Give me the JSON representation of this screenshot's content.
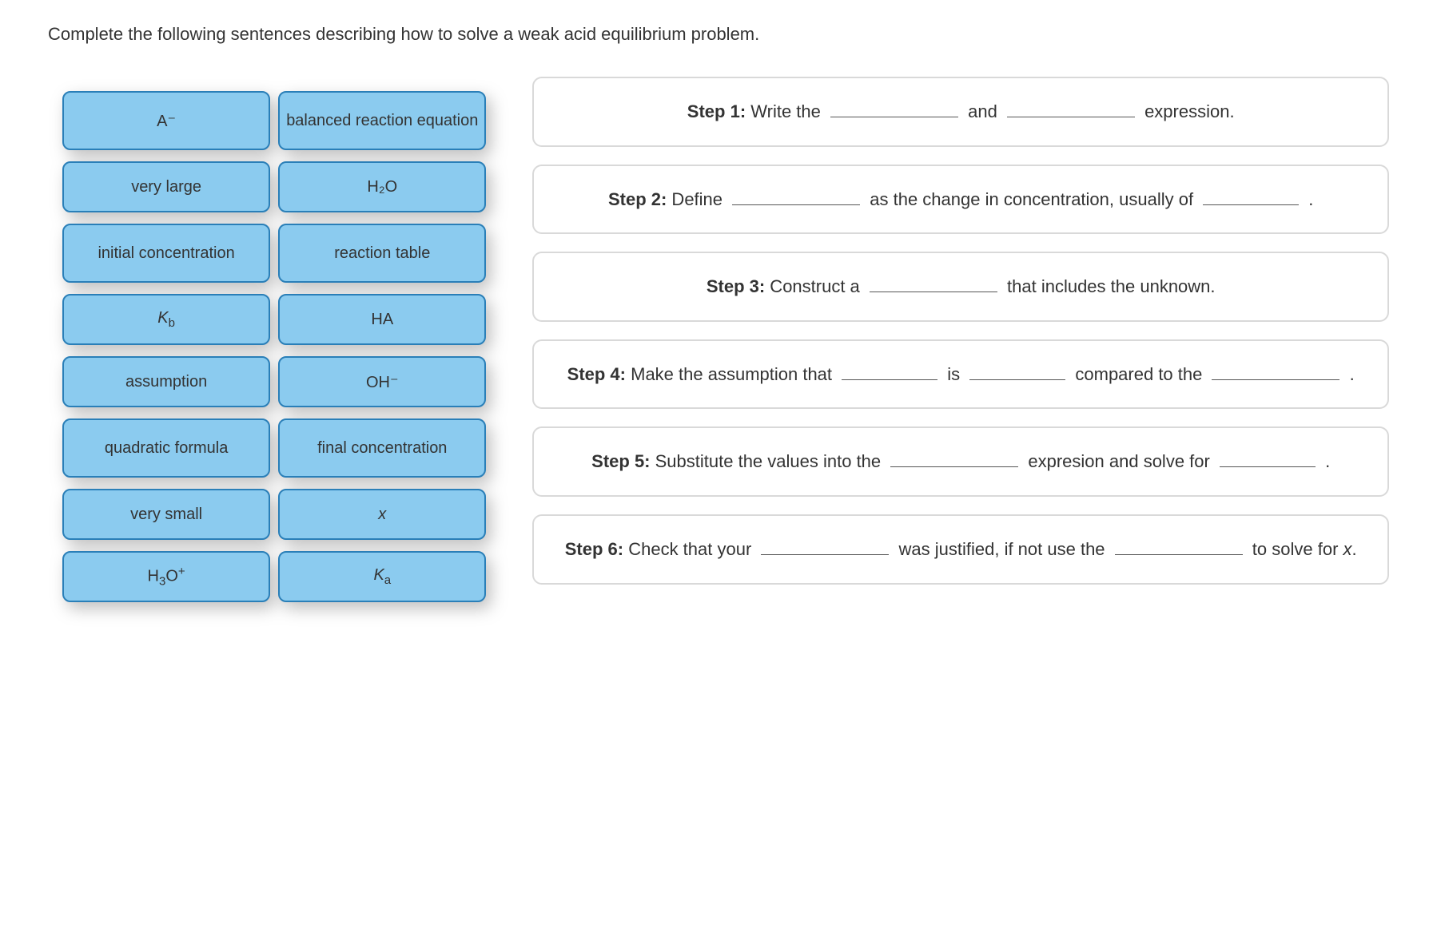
{
  "instruction": "Complete the following sentences describing how to solve a weak acid equilibrium problem.",
  "tiles": {
    "a_minus": "A⁻",
    "balanced": "balanced reaction equation",
    "very_large": "very large",
    "h2o": "H₂O",
    "initial_conc": "initial concentration",
    "reaction_table": "reaction table",
    "kb": "K",
    "kb_sub": "b",
    "ha": "HA",
    "assumption": "assumption",
    "oh_minus": "OH⁻",
    "quadratic": "quadratic formula",
    "final_conc": "final concentration",
    "very_small": "very small",
    "x": "x",
    "h3o_plus_h": "H",
    "h3o_plus_3": "3",
    "h3o_plus_o": "O",
    "h3o_plus_plus": "+",
    "ka": "K",
    "ka_sub": "a"
  },
  "steps": {
    "s1": {
      "label": "Step 1:",
      "t1": " Write the ",
      "t2": " and ",
      "t3": " expression."
    },
    "s2": {
      "label": "Step 2:",
      "t1": " Define ",
      "t2": " as the change in concentration, usually of ",
      "t3": " ."
    },
    "s3": {
      "label": "Step 3:",
      "t1": " Construct a ",
      "t2": " that includes the unknown."
    },
    "s4": {
      "label": "Step 4:",
      "t1": " Make the assumption that ",
      "t2": " is ",
      "t3": " compared to the ",
      "t4": " ."
    },
    "s5": {
      "label": "Step 5:",
      "t1": " Substitute the values into the ",
      "t2": " expresion and solve for ",
      "t3": " ."
    },
    "s6": {
      "label": "Step 6:",
      "t1": " Check that your ",
      "t2": " was justified, if not use the ",
      "t3": " to solve for ",
      "t4": "x",
      "t5": "."
    }
  }
}
